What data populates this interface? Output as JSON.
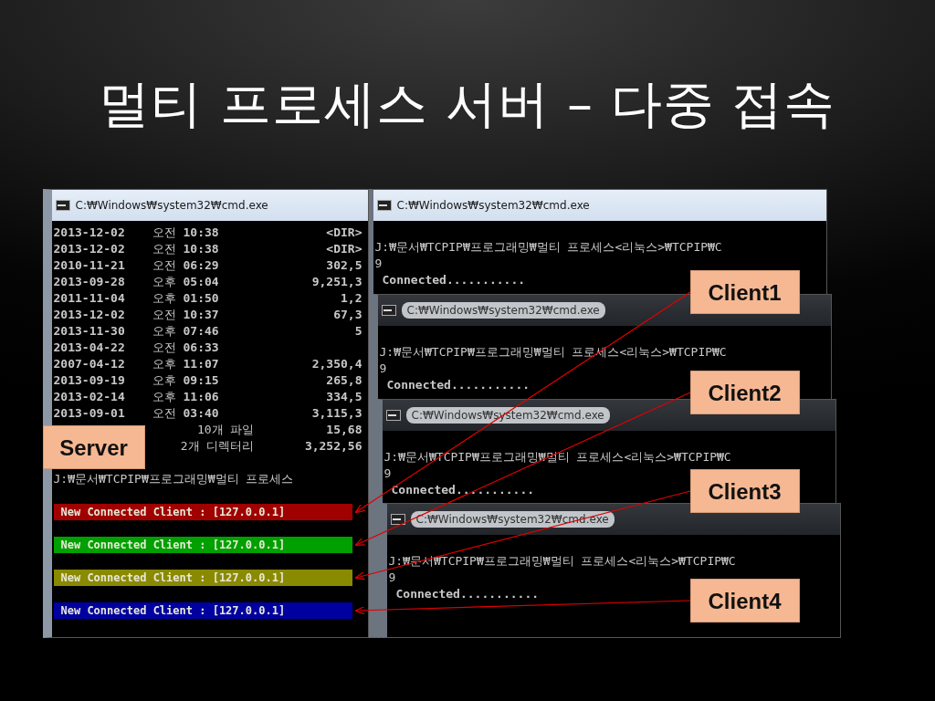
{
  "title": "멀티 프로세스 서버 – 다중 접속",
  "server_window": {
    "title": "C:₩Windows₩system32₩cmd.exe",
    "active": true,
    "callout": "Server",
    "listing": [
      {
        "date": "2013-12-02",
        "ampm": "오전",
        "time": "10:38",
        "size": "<DIR>"
      },
      {
        "date": "2013-12-02",
        "ampm": "오전",
        "time": "10:38",
        "size": "<DIR>"
      },
      {
        "date": "2010-11-21",
        "ampm": "오전",
        "time": "06:29",
        "size": "302,5"
      },
      {
        "date": "2013-09-28",
        "ampm": "오후",
        "time": "05:04",
        "size": "9,251,3"
      },
      {
        "date": "2011-11-04",
        "ampm": "오후",
        "time": "01:50",
        "size": "1,2"
      },
      {
        "date": "2013-12-02",
        "ampm": "오전",
        "time": "10:37",
        "size": "67,3"
      },
      {
        "date": "2013-11-30",
        "ampm": "오후",
        "time": "07:46",
        "size": "5"
      },
      {
        "date": "2013-04-22",
        "ampm": "오전",
        "time": "06:33"
      },
      {
        "date": "2007-04-12",
        "ampm": "오후",
        "time": "11:07",
        "size": "2,350,4"
      },
      {
        "date": "2013-09-19",
        "ampm": "오후",
        "time": "09:15",
        "size": "265,8"
      },
      {
        "date": "2013-02-14",
        "ampm": "오후",
        "time": "11:06",
        "size": "334,5"
      },
      {
        "date": "2013-09-01",
        "ampm": "오전",
        "time": "03:40",
        "size": "3,115,3"
      }
    ],
    "summary": [
      {
        "count": "10개 파일",
        "size": "15,68"
      },
      {
        "count": "2개 디렉터리",
        "size": "3,252,56"
      }
    ],
    "prompt": "J:₩문서₩TCPIP₩프로그래밍₩멀티 프로세스",
    "connections": [
      {
        "text": "New Connected Client : [127.0.0.1]",
        "color": "#a00000"
      },
      {
        "text": "New Connected Client : [127.0.0.1]",
        "color": "#00a000"
      },
      {
        "text": "New Connected Client : [127.0.0.1]",
        "color": "#8a8a00"
      },
      {
        "text": "New Connected Client : [127.0.0.1]",
        "color": "#0000a0"
      }
    ]
  },
  "client_windows": [
    {
      "title": "C:₩Windows₩system32₩cmd.exe",
      "active": true,
      "callout": "Client1",
      "lines": [
        "J:₩문서₩TCPIP₩프로그래밍₩멀티 프로세스<리눅스>₩TCPIP₩C",
        "9",
        "Connected..........."
      ]
    },
    {
      "title": "C:₩Windows₩system32₩cmd.exe",
      "active": false,
      "callout": "Client2",
      "lines": [
        "J:₩문서₩TCPIP₩프로그래밍₩멀티 프로세스<리눅스>₩TCPIP₩C",
        "9",
        "Connected..........."
      ]
    },
    {
      "title": "C:₩Windows₩system32₩cmd.exe",
      "active": false,
      "callout": "Client3",
      "lines": [
        "J:₩문서₩TCPIP₩프로그래밍₩멀티 프로세스<리눅스>₩TCPIP₩C",
        "9",
        "Connected..........."
      ]
    },
    {
      "title": "C:₩Windows₩system32₩cmd.exe",
      "active": false,
      "callout": "Client4",
      "lines": [
        "J:₩문서₩TCPIP₩프로그래밍₩멀티 프로세스<리눅스>₩TCPIP₩C",
        "9",
        "Connected..........."
      ]
    }
  ]
}
